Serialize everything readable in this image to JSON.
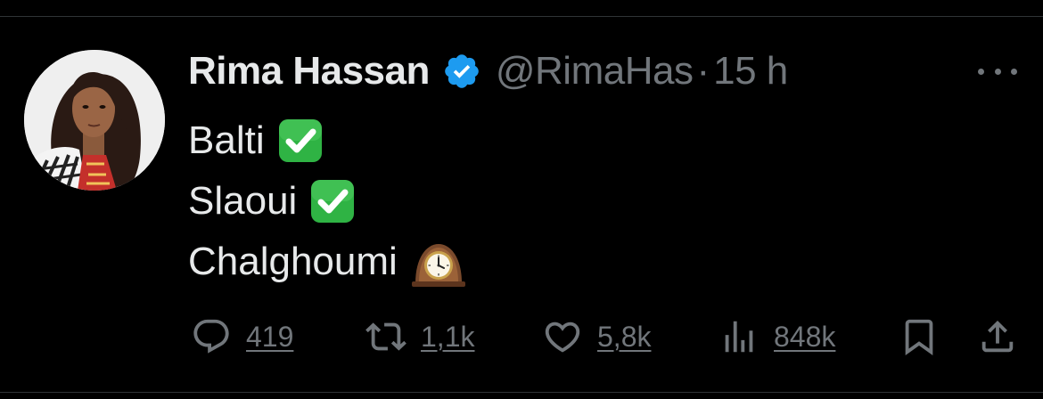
{
  "tweet": {
    "author": {
      "display_name": "Rima Hassan",
      "handle": "@RimaHas",
      "verified": true,
      "verified_color": "#1d9bf0"
    },
    "separator": "·",
    "time": "15 h",
    "lines": [
      {
        "text": "Balti",
        "emoji": "white-check-mark-icon"
      },
      {
        "text": "Slaoui",
        "emoji": "white-check-mark-icon"
      },
      {
        "text": "Chalghoumi",
        "emoji": "mantelpiece-clock-icon"
      }
    ]
  },
  "actions": {
    "replies": "419",
    "retweets": "1,1k",
    "likes": "5,8k",
    "views": "848k"
  },
  "icons": {
    "reply": "reply-icon",
    "retweet": "retweet-icon",
    "like": "heart-icon",
    "views": "views-icon",
    "bookmark": "bookmark-icon",
    "share": "share-icon",
    "more": "more-icon"
  },
  "colors": {
    "background": "#000000",
    "text": "#e7e9ea",
    "muted": "#71767b",
    "divider": "#2f3336",
    "check_green": "#2fb344"
  }
}
